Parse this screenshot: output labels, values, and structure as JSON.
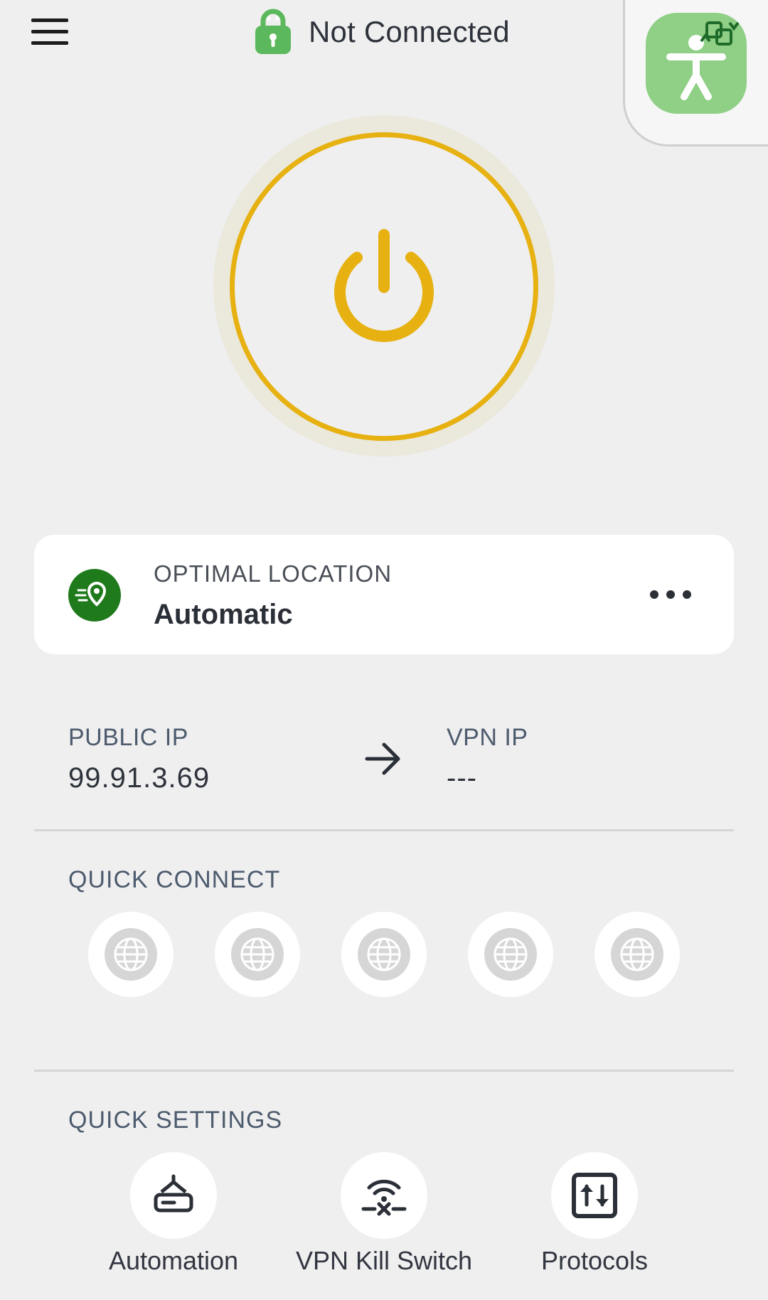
{
  "header": {
    "status_text": "Not Connected",
    "status_icon": "lock-icon",
    "menu_icon": "hamburger-menu-icon",
    "accessibility_icon": "accessibility-icon"
  },
  "power": {
    "icon": "power-icon",
    "accent_color": "#e6b111"
  },
  "location": {
    "label": "OPTIMAL LOCATION",
    "value": "Automatic",
    "icon": "fast-location-icon",
    "more_icon": "more-dots-icon"
  },
  "ip": {
    "public_label": "PUBLIC IP",
    "public_value": "99.91.3.69",
    "vpn_label": "VPN IP",
    "vpn_value": "---"
  },
  "quick_connect": {
    "title": "QUICK CONNECT",
    "slots": [
      "globe-icon",
      "globe-icon",
      "globe-icon",
      "globe-icon",
      "globe-icon"
    ]
  },
  "quick_settings": {
    "title": "QUICK SETTINGS",
    "items": [
      {
        "label": "Automation",
        "icon": "automation-icon"
      },
      {
        "label": "VPN Kill Switch",
        "icon": "kill-switch-icon"
      },
      {
        "label": "Protocols",
        "icon": "protocols-icon"
      }
    ]
  },
  "colors": {
    "background": "#efefef",
    "brand_green": "#8fcf86",
    "location_green": "#1f7a1c",
    "power_yellow": "#e6b111"
  }
}
